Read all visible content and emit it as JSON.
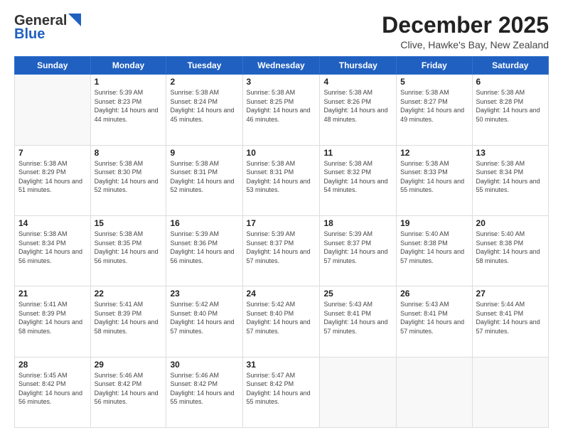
{
  "header": {
    "logo_general": "General",
    "logo_blue": "Blue",
    "month_title": "December 2025",
    "location": "Clive, Hawke's Bay, New Zealand"
  },
  "days_of_week": [
    "Sunday",
    "Monday",
    "Tuesday",
    "Wednesday",
    "Thursday",
    "Friday",
    "Saturday"
  ],
  "weeks": [
    [
      {
        "day": "",
        "sunrise": "",
        "sunset": "",
        "daylight": ""
      },
      {
        "day": "1",
        "sunrise": "Sunrise: 5:39 AM",
        "sunset": "Sunset: 8:23 PM",
        "daylight": "Daylight: 14 hours and 44 minutes."
      },
      {
        "day": "2",
        "sunrise": "Sunrise: 5:38 AM",
        "sunset": "Sunset: 8:24 PM",
        "daylight": "Daylight: 14 hours and 45 minutes."
      },
      {
        "day": "3",
        "sunrise": "Sunrise: 5:38 AM",
        "sunset": "Sunset: 8:25 PM",
        "daylight": "Daylight: 14 hours and 46 minutes."
      },
      {
        "day": "4",
        "sunrise": "Sunrise: 5:38 AM",
        "sunset": "Sunset: 8:26 PM",
        "daylight": "Daylight: 14 hours and 48 minutes."
      },
      {
        "day": "5",
        "sunrise": "Sunrise: 5:38 AM",
        "sunset": "Sunset: 8:27 PM",
        "daylight": "Daylight: 14 hours and 49 minutes."
      },
      {
        "day": "6",
        "sunrise": "Sunrise: 5:38 AM",
        "sunset": "Sunset: 8:28 PM",
        "daylight": "Daylight: 14 hours and 50 minutes."
      }
    ],
    [
      {
        "day": "7",
        "sunrise": "Sunrise: 5:38 AM",
        "sunset": "Sunset: 8:29 PM",
        "daylight": "Daylight: 14 hours and 51 minutes."
      },
      {
        "day": "8",
        "sunrise": "Sunrise: 5:38 AM",
        "sunset": "Sunset: 8:30 PM",
        "daylight": "Daylight: 14 hours and 52 minutes."
      },
      {
        "day": "9",
        "sunrise": "Sunrise: 5:38 AM",
        "sunset": "Sunset: 8:31 PM",
        "daylight": "Daylight: 14 hours and 52 minutes."
      },
      {
        "day": "10",
        "sunrise": "Sunrise: 5:38 AM",
        "sunset": "Sunset: 8:31 PM",
        "daylight": "Daylight: 14 hours and 53 minutes."
      },
      {
        "day": "11",
        "sunrise": "Sunrise: 5:38 AM",
        "sunset": "Sunset: 8:32 PM",
        "daylight": "Daylight: 14 hours and 54 minutes."
      },
      {
        "day": "12",
        "sunrise": "Sunrise: 5:38 AM",
        "sunset": "Sunset: 8:33 PM",
        "daylight": "Daylight: 14 hours and 55 minutes."
      },
      {
        "day": "13",
        "sunrise": "Sunrise: 5:38 AM",
        "sunset": "Sunset: 8:34 PM",
        "daylight": "Daylight: 14 hours and 55 minutes."
      }
    ],
    [
      {
        "day": "14",
        "sunrise": "Sunrise: 5:38 AM",
        "sunset": "Sunset: 8:34 PM",
        "daylight": "Daylight: 14 hours and 56 minutes."
      },
      {
        "day": "15",
        "sunrise": "Sunrise: 5:38 AM",
        "sunset": "Sunset: 8:35 PM",
        "daylight": "Daylight: 14 hours and 56 minutes."
      },
      {
        "day": "16",
        "sunrise": "Sunrise: 5:39 AM",
        "sunset": "Sunset: 8:36 PM",
        "daylight": "Daylight: 14 hours and 56 minutes."
      },
      {
        "day": "17",
        "sunrise": "Sunrise: 5:39 AM",
        "sunset": "Sunset: 8:37 PM",
        "daylight": "Daylight: 14 hours and 57 minutes."
      },
      {
        "day": "18",
        "sunrise": "Sunrise: 5:39 AM",
        "sunset": "Sunset: 8:37 PM",
        "daylight": "Daylight: 14 hours and 57 minutes."
      },
      {
        "day": "19",
        "sunrise": "Sunrise: 5:40 AM",
        "sunset": "Sunset: 8:38 PM",
        "daylight": "Daylight: 14 hours and 57 minutes."
      },
      {
        "day": "20",
        "sunrise": "Sunrise: 5:40 AM",
        "sunset": "Sunset: 8:38 PM",
        "daylight": "Daylight: 14 hours and 58 minutes."
      }
    ],
    [
      {
        "day": "21",
        "sunrise": "Sunrise: 5:41 AM",
        "sunset": "Sunset: 8:39 PM",
        "daylight": "Daylight: 14 hours and 58 minutes."
      },
      {
        "day": "22",
        "sunrise": "Sunrise: 5:41 AM",
        "sunset": "Sunset: 8:39 PM",
        "daylight": "Daylight: 14 hours and 58 minutes."
      },
      {
        "day": "23",
        "sunrise": "Sunrise: 5:42 AM",
        "sunset": "Sunset: 8:40 PM",
        "daylight": "Daylight: 14 hours and 57 minutes."
      },
      {
        "day": "24",
        "sunrise": "Sunrise: 5:42 AM",
        "sunset": "Sunset: 8:40 PM",
        "daylight": "Daylight: 14 hours and 57 minutes."
      },
      {
        "day": "25",
        "sunrise": "Sunrise: 5:43 AM",
        "sunset": "Sunset: 8:41 PM",
        "daylight": "Daylight: 14 hours and 57 minutes."
      },
      {
        "day": "26",
        "sunrise": "Sunrise: 5:43 AM",
        "sunset": "Sunset: 8:41 PM",
        "daylight": "Daylight: 14 hours and 57 minutes."
      },
      {
        "day": "27",
        "sunrise": "Sunrise: 5:44 AM",
        "sunset": "Sunset: 8:41 PM",
        "daylight": "Daylight: 14 hours and 57 minutes."
      }
    ],
    [
      {
        "day": "28",
        "sunrise": "Sunrise: 5:45 AM",
        "sunset": "Sunset: 8:42 PM",
        "daylight": "Daylight: 14 hours and 56 minutes."
      },
      {
        "day": "29",
        "sunrise": "Sunrise: 5:46 AM",
        "sunset": "Sunset: 8:42 PM",
        "daylight": "Daylight: 14 hours and 56 minutes."
      },
      {
        "day": "30",
        "sunrise": "Sunrise: 5:46 AM",
        "sunset": "Sunset: 8:42 PM",
        "daylight": "Daylight: 14 hours and 55 minutes."
      },
      {
        "day": "31",
        "sunrise": "Sunrise: 5:47 AM",
        "sunset": "Sunset: 8:42 PM",
        "daylight": "Daylight: 14 hours and 55 minutes."
      },
      {
        "day": "",
        "sunrise": "",
        "sunset": "",
        "daylight": ""
      },
      {
        "day": "",
        "sunrise": "",
        "sunset": "",
        "daylight": ""
      },
      {
        "day": "",
        "sunrise": "",
        "sunset": "",
        "daylight": ""
      }
    ]
  ]
}
